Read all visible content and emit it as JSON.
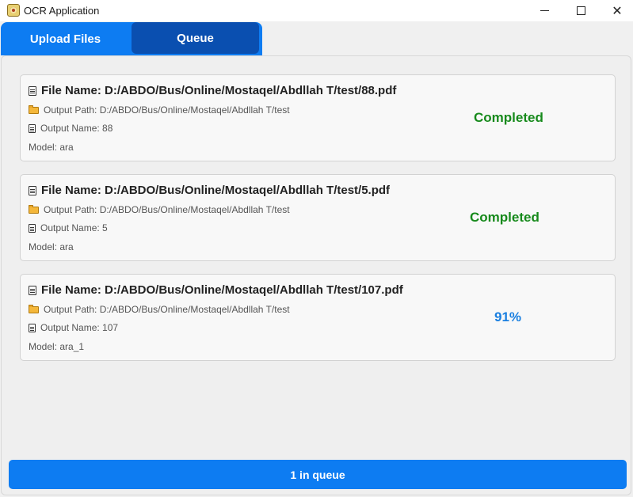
{
  "window": {
    "title": "OCR Application",
    "icon": "ocr-app-icon",
    "controls": [
      "minimize-icon",
      "maximize-icon",
      "close-icon"
    ],
    "close_glyph": "✕"
  },
  "tabs": [
    {
      "label": "Upload Files",
      "active": false
    },
    {
      "label": "Queue",
      "active": true
    }
  ],
  "colors": {
    "accent": "#0d7cf2",
    "active_tab": "#0a4fb0",
    "completed": "#178a1c",
    "progress": "#1a7fe0"
  },
  "queue": {
    "items": [
      {
        "file_name": "File Name: D:/ABDO/Bus/Online/Mostaqel/Abdllah T/test/88.pdf",
        "output_path": "Output Path: D:/ABDO/Bus/Online/Mostaqel/Abdllah T/test",
        "output_name": "Output Name: 88",
        "model": "Model: ara",
        "status": "Completed"
      },
      {
        "file_name": "File Name: D:/ABDO/Bus/Online/Mostaqel/Abdllah T/test/5.pdf",
        "output_path": "Output Path: D:/ABDO/Bus/Online/Mostaqel/Abdllah T/test",
        "output_name": "Output Name: 5",
        "model": "Model: ara",
        "status": "Completed"
      },
      {
        "file_name": "File Name: D:/ABDO/Bus/Online/Mostaqel/Abdllah T/test/107.pdf",
        "output_path": "Output Path: D:/ABDO/Bus/Online/Mostaqel/Abdllah T/test",
        "output_name": "Output Name: 107",
        "model": "Model: ara_1",
        "status": "91%"
      }
    ]
  },
  "footer": {
    "queue_count_label": "1 in queue"
  }
}
